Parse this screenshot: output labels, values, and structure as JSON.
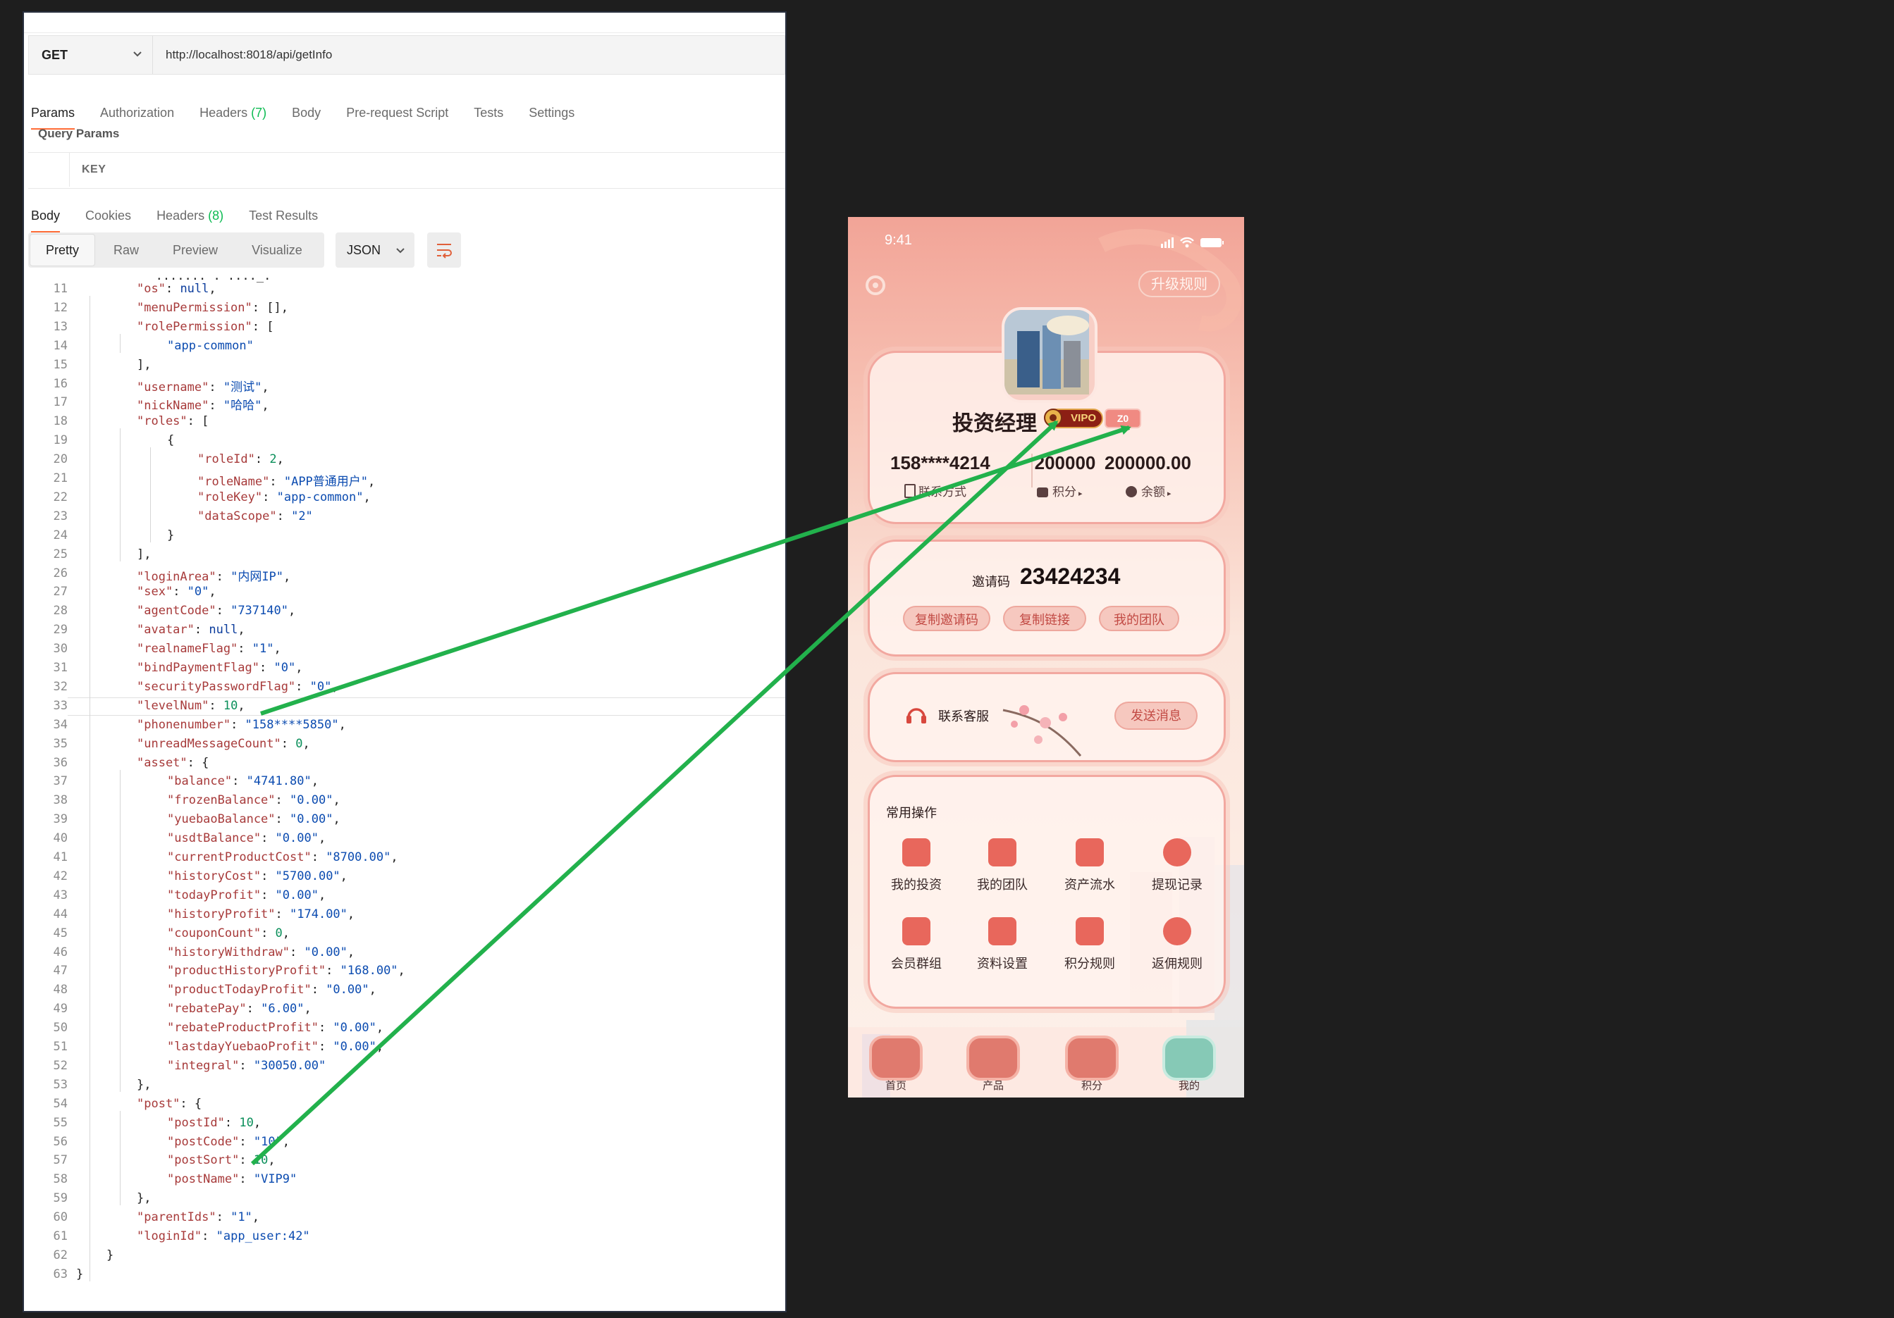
{
  "request": {
    "method": "GET",
    "url": "http://localhost:8018/api/getInfo",
    "tabs": [
      {
        "label": "Params",
        "count": ""
      },
      {
        "label": "Authorization",
        "count": ""
      },
      {
        "label": "Headers",
        "count": "(7)"
      },
      {
        "label": "Body",
        "count": ""
      },
      {
        "label": "Pre-request Script",
        "count": ""
      },
      {
        "label": "Tests",
        "count": ""
      },
      {
        "label": "Settings",
        "count": ""
      }
    ],
    "query_params_label": "Query Params",
    "key_header": "KEY"
  },
  "response": {
    "tabs": [
      {
        "label": "Body",
        "count": ""
      },
      {
        "label": "Cookies",
        "count": ""
      },
      {
        "label": "Headers",
        "count": "(8)"
      },
      {
        "label": "Test Results",
        "count": ""
      }
    ],
    "views": [
      "Pretty",
      "Raw",
      "Preview",
      "Visualize"
    ],
    "format": "JSON",
    "lines": [
      {
        "n": "11",
        "i": 1,
        "t": [
          [
            "k",
            "\"os\""
          ],
          [
            "p",
            ": "
          ],
          [
            "l",
            "null"
          ],
          [
            "p",
            ","
          ]
        ]
      },
      {
        "n": "12",
        "i": 1,
        "t": [
          [
            "k",
            "\"menuPermission\""
          ],
          [
            "p",
            ": [],"
          ]
        ]
      },
      {
        "n": "13",
        "i": 1,
        "t": [
          [
            "k",
            "\"rolePermission\""
          ],
          [
            "p",
            ": ["
          ]
        ]
      },
      {
        "n": "14",
        "i": 2,
        "t": [
          [
            "s",
            "\"app-common\""
          ]
        ]
      },
      {
        "n": "15",
        "i": 1,
        "t": [
          [
            "p",
            "],"
          ]
        ]
      },
      {
        "n": "16",
        "i": 1,
        "t": [
          [
            "k",
            "\"username\""
          ],
          [
            "p",
            ": "
          ],
          [
            "s",
            "\"测试\""
          ],
          [
            "p",
            ","
          ]
        ]
      },
      {
        "n": "17",
        "i": 1,
        "t": [
          [
            "k",
            "\"nickName\""
          ],
          [
            "p",
            ": "
          ],
          [
            "s",
            "\"哈哈\""
          ],
          [
            "p",
            ","
          ]
        ]
      },
      {
        "n": "18",
        "i": 1,
        "t": [
          [
            "k",
            "\"roles\""
          ],
          [
            "p",
            ": ["
          ]
        ]
      },
      {
        "n": "19",
        "i": 2,
        "t": [
          [
            "p",
            "{"
          ]
        ]
      },
      {
        "n": "20",
        "i": 3,
        "t": [
          [
            "k",
            "\"roleId\""
          ],
          [
            "p",
            ": "
          ],
          [
            "n",
            "2"
          ],
          [
            "p",
            ","
          ]
        ]
      },
      {
        "n": "21",
        "i": 3,
        "t": [
          [
            "k",
            "\"roleName\""
          ],
          [
            "p",
            ": "
          ],
          [
            "s",
            "\"APP普通用户\""
          ],
          [
            "p",
            ","
          ]
        ]
      },
      {
        "n": "22",
        "i": 3,
        "t": [
          [
            "k",
            "\"roleKey\""
          ],
          [
            "p",
            ": "
          ],
          [
            "s",
            "\"app-common\""
          ],
          [
            "p",
            ","
          ]
        ]
      },
      {
        "n": "23",
        "i": 3,
        "t": [
          [
            "k",
            "\"dataScope\""
          ],
          [
            "p",
            ": "
          ],
          [
            "s",
            "\"2\""
          ]
        ]
      },
      {
        "n": "24",
        "i": 2,
        "t": [
          [
            "p",
            "}"
          ]
        ]
      },
      {
        "n": "25",
        "i": 1,
        "t": [
          [
            "p",
            "],"
          ]
        ]
      },
      {
        "n": "26",
        "i": 1,
        "t": [
          [
            "k",
            "\"loginArea\""
          ],
          [
            "p",
            ": "
          ],
          [
            "s",
            "\"内网IP\""
          ],
          [
            "p",
            ","
          ]
        ]
      },
      {
        "n": "27",
        "i": 1,
        "t": [
          [
            "k",
            "\"sex\""
          ],
          [
            "p",
            ": "
          ],
          [
            "s",
            "\"0\""
          ],
          [
            "p",
            ","
          ]
        ]
      },
      {
        "n": "28",
        "i": 1,
        "t": [
          [
            "k",
            "\"agentCode\""
          ],
          [
            "p",
            ": "
          ],
          [
            "s",
            "\"737140\""
          ],
          [
            "p",
            ","
          ]
        ]
      },
      {
        "n": "29",
        "i": 1,
        "t": [
          [
            "k",
            "\"avatar\""
          ],
          [
            "p",
            ": "
          ],
          [
            "l",
            "null"
          ],
          [
            "p",
            ","
          ]
        ]
      },
      {
        "n": "30",
        "i": 1,
        "t": [
          [
            "k",
            "\"realnameFlag\""
          ],
          [
            "p",
            ": "
          ],
          [
            "s",
            "\"1\""
          ],
          [
            "p",
            ","
          ]
        ]
      },
      {
        "n": "31",
        "i": 1,
        "t": [
          [
            "k",
            "\"bindPaymentFlag\""
          ],
          [
            "p",
            ": "
          ],
          [
            "s",
            "\"0\""
          ],
          [
            "p",
            ","
          ]
        ]
      },
      {
        "n": "32",
        "i": 1,
        "t": [
          [
            "k",
            "\"securityPasswordFlag\""
          ],
          [
            "p",
            ": "
          ],
          [
            "s",
            "\"0\""
          ],
          [
            "p",
            ","
          ]
        ]
      },
      {
        "n": "33",
        "i": 1,
        "t": [
          [
            "k",
            "\"levelNum\""
          ],
          [
            "p",
            ": "
          ],
          [
            "n",
            "10"
          ],
          [
            "p",
            ","
          ]
        ]
      },
      {
        "n": "34",
        "i": 1,
        "t": [
          [
            "k",
            "\"phonenumber\""
          ],
          [
            "p",
            ": "
          ],
          [
            "s",
            "\"158****5850\""
          ],
          [
            "p",
            ","
          ]
        ]
      },
      {
        "n": "35",
        "i": 1,
        "t": [
          [
            "k",
            "\"unreadMessageCount\""
          ],
          [
            "p",
            ": "
          ],
          [
            "n",
            "0"
          ],
          [
            "p",
            ","
          ]
        ]
      },
      {
        "n": "36",
        "i": 1,
        "t": [
          [
            "k",
            "\"asset\""
          ],
          [
            "p",
            ": {"
          ]
        ]
      },
      {
        "n": "37",
        "i": 2,
        "t": [
          [
            "k",
            "\"balance\""
          ],
          [
            "p",
            ": "
          ],
          [
            "s",
            "\"4741.80\""
          ],
          [
            "p",
            ","
          ]
        ]
      },
      {
        "n": "38",
        "i": 2,
        "t": [
          [
            "k",
            "\"frozenBalance\""
          ],
          [
            "p",
            ": "
          ],
          [
            "s",
            "\"0.00\""
          ],
          [
            "p",
            ","
          ]
        ]
      },
      {
        "n": "39",
        "i": 2,
        "t": [
          [
            "k",
            "\"yuebaoBalance\""
          ],
          [
            "p",
            ": "
          ],
          [
            "s",
            "\"0.00\""
          ],
          [
            "p",
            ","
          ]
        ]
      },
      {
        "n": "40",
        "i": 2,
        "t": [
          [
            "k",
            "\"usdtBalance\""
          ],
          [
            "p",
            ": "
          ],
          [
            "s",
            "\"0.00\""
          ],
          [
            "p",
            ","
          ]
        ]
      },
      {
        "n": "41",
        "i": 2,
        "t": [
          [
            "k",
            "\"currentProductCost\""
          ],
          [
            "p",
            ": "
          ],
          [
            "s",
            "\"8700.00\""
          ],
          [
            "p",
            ","
          ]
        ]
      },
      {
        "n": "42",
        "i": 2,
        "t": [
          [
            "k",
            "\"historyCost\""
          ],
          [
            "p",
            ": "
          ],
          [
            "s",
            "\"5700.00\""
          ],
          [
            "p",
            ","
          ]
        ]
      },
      {
        "n": "43",
        "i": 2,
        "t": [
          [
            "k",
            "\"todayProfit\""
          ],
          [
            "p",
            ": "
          ],
          [
            "s",
            "\"0.00\""
          ],
          [
            "p",
            ","
          ]
        ]
      },
      {
        "n": "44",
        "i": 2,
        "t": [
          [
            "k",
            "\"historyProfit\""
          ],
          [
            "p",
            ": "
          ],
          [
            "s",
            "\"174.00\""
          ],
          [
            "p",
            ","
          ]
        ]
      },
      {
        "n": "45",
        "i": 2,
        "t": [
          [
            "k",
            "\"couponCount\""
          ],
          [
            "p",
            ": "
          ],
          [
            "n",
            "0"
          ],
          [
            "p",
            ","
          ]
        ]
      },
      {
        "n": "46",
        "i": 2,
        "t": [
          [
            "k",
            "\"historyWithdraw\""
          ],
          [
            "p",
            ": "
          ],
          [
            "s",
            "\"0.00\""
          ],
          [
            "p",
            ","
          ]
        ]
      },
      {
        "n": "47",
        "i": 2,
        "t": [
          [
            "k",
            "\"productHistoryProfit\""
          ],
          [
            "p",
            ": "
          ],
          [
            "s",
            "\"168.00\""
          ],
          [
            "p",
            ","
          ]
        ]
      },
      {
        "n": "48",
        "i": 2,
        "t": [
          [
            "k",
            "\"productTodayProfit\""
          ],
          [
            "p",
            ": "
          ],
          [
            "s",
            "\"0.00\""
          ],
          [
            "p",
            ","
          ]
        ]
      },
      {
        "n": "49",
        "i": 2,
        "t": [
          [
            "k",
            "\"rebatePay\""
          ],
          [
            "p",
            ": "
          ],
          [
            "s",
            "\"6.00\""
          ],
          [
            "p",
            ","
          ]
        ]
      },
      {
        "n": "50",
        "i": 2,
        "t": [
          [
            "k",
            "\"rebateProductProfit\""
          ],
          [
            "p",
            ": "
          ],
          [
            "s",
            "\"0.00\""
          ],
          [
            "p",
            ","
          ]
        ]
      },
      {
        "n": "51",
        "i": 2,
        "t": [
          [
            "k",
            "\"lastdayYuebaoProfit\""
          ],
          [
            "p",
            ": "
          ],
          [
            "s",
            "\"0.00\""
          ],
          [
            "p",
            ","
          ]
        ]
      },
      {
        "n": "52",
        "i": 2,
        "t": [
          [
            "k",
            "\"integral\""
          ],
          [
            "p",
            ": "
          ],
          [
            "s",
            "\"30050.00\""
          ]
        ]
      },
      {
        "n": "53",
        "i": 1,
        "t": [
          [
            "p",
            "},"
          ]
        ]
      },
      {
        "n": "54",
        "i": 1,
        "t": [
          [
            "k",
            "\"post\""
          ],
          [
            "p",
            ": {"
          ]
        ]
      },
      {
        "n": "55",
        "i": 2,
        "t": [
          [
            "k",
            "\"postId\""
          ],
          [
            "p",
            ": "
          ],
          [
            "n",
            "10"
          ],
          [
            "p",
            ","
          ]
        ]
      },
      {
        "n": "56",
        "i": 2,
        "t": [
          [
            "k",
            "\"postCode\""
          ],
          [
            "p",
            ": "
          ],
          [
            "s",
            "\"10\""
          ],
          [
            "p",
            ","
          ]
        ]
      },
      {
        "n": "57",
        "i": 2,
        "t": [
          [
            "k",
            "\"postSort\""
          ],
          [
            "p",
            ": "
          ],
          [
            "n",
            "10"
          ],
          [
            "p",
            ","
          ]
        ]
      },
      {
        "n": "58",
        "i": 2,
        "t": [
          [
            "k",
            "\"postName\""
          ],
          [
            "p",
            ": "
          ],
          [
            "s",
            "\"VIP9\""
          ]
        ]
      },
      {
        "n": "59",
        "i": 1,
        "t": [
          [
            "p",
            "},"
          ]
        ]
      },
      {
        "n": "60",
        "i": 1,
        "t": [
          [
            "k",
            "\"parentIds\""
          ],
          [
            "p",
            ": "
          ],
          [
            "s",
            "\"1\""
          ],
          [
            "p",
            ","
          ]
        ]
      },
      {
        "n": "61",
        "i": 1,
        "t": [
          [
            "k",
            "\"loginId\""
          ],
          [
            "p",
            ": "
          ],
          [
            "s",
            "\"app_user:42\""
          ]
        ]
      },
      {
        "n": "62",
        "i": 0,
        "t": [
          [
            "p",
            "}"
          ]
        ]
      },
      {
        "n": "63",
        "i": -1,
        "t": [
          [
            "p",
            "}"
          ]
        ]
      }
    ]
  },
  "phone": {
    "time": "9:41",
    "upgrade_rules": "升级规则",
    "name": "投资经理",
    "vip_badge": "VIPO",
    "z_badge": "Z0",
    "phone_masked": "158****4214",
    "points": "200000",
    "balance": "200000.00",
    "contact_label": "联系方式",
    "points_label": "积分",
    "balance_label": "余额",
    "invite_label": "邀请码",
    "invite_code": "23424234",
    "btn_copy_code": "复制邀请码",
    "btn_copy_link": "复制链接",
    "btn_my_team": "我的团队",
    "service_label": "联系客服",
    "btn_send_msg": "发送消息",
    "ops_title": "常用操作",
    "ops": [
      "我的投资",
      "我的团队",
      "资产流水",
      "提现记录",
      "会员群组",
      "资料设置",
      "积分规则",
      "返佣规则"
    ],
    "nav": [
      "首页",
      "产品",
      "积分",
      "我的"
    ],
    "accent_color": "#e8675c",
    "arrow_color": "#22b14c"
  }
}
